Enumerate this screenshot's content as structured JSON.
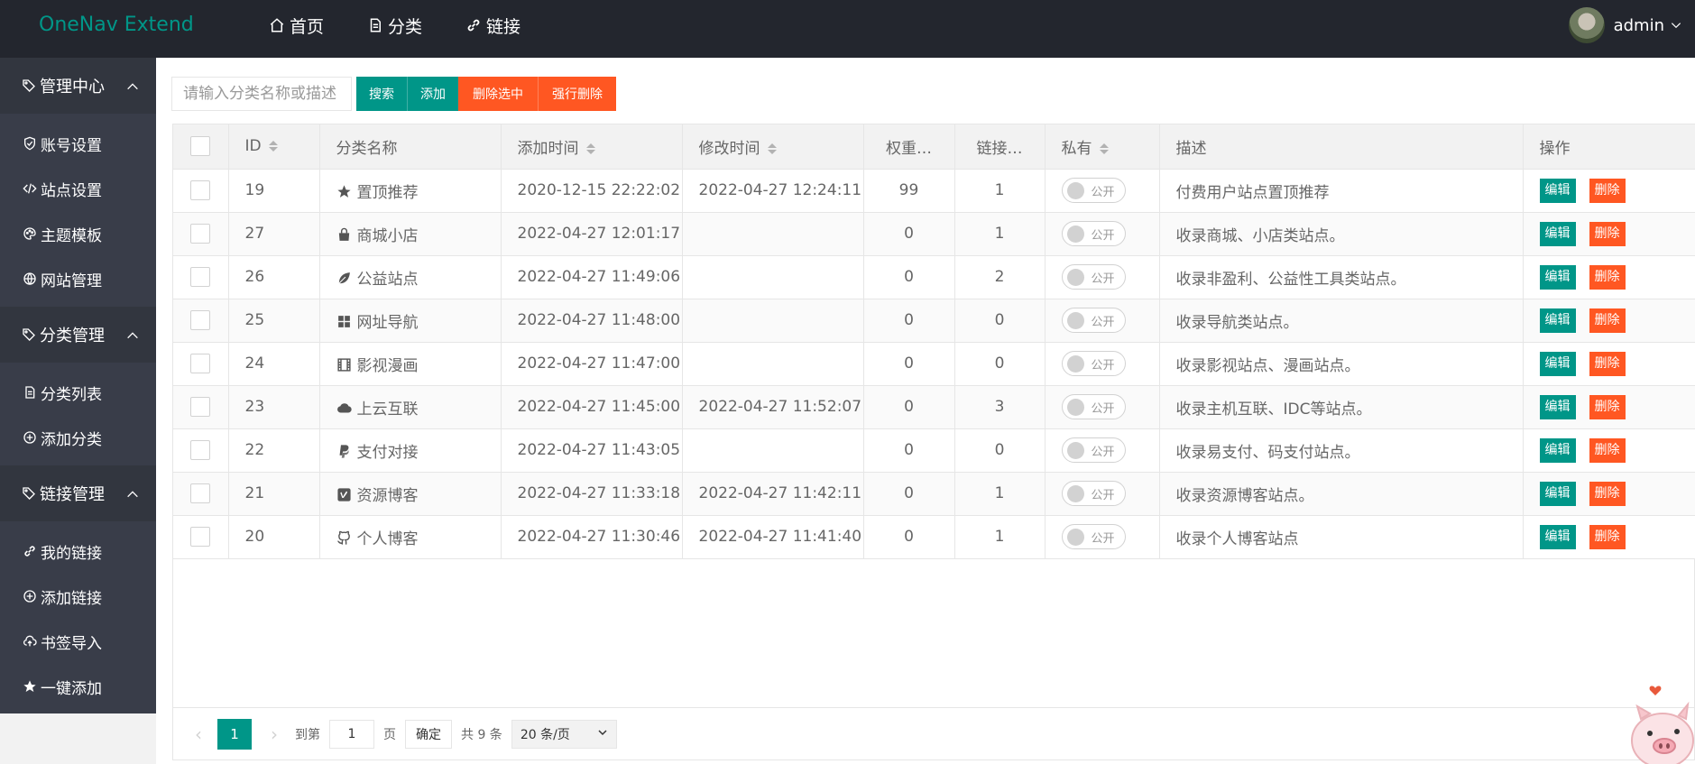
{
  "header": {
    "logo": "OneNav Extend",
    "nav": [
      {
        "label": "首页",
        "icon": "home-icon"
      },
      {
        "label": "分类",
        "icon": "document-icon"
      },
      {
        "label": "链接",
        "icon": "link-icon"
      }
    ],
    "user": {
      "name": "admin"
    }
  },
  "sidebar": {
    "groups": [
      {
        "title": "管理中心",
        "items": [
          "账号设置",
          "站点设置",
          "主题模板",
          "网站管理"
        ]
      },
      {
        "title": "分类管理",
        "items": [
          "分类列表",
          "添加分类"
        ]
      },
      {
        "title": "链接管理",
        "items": [
          "我的链接",
          "添加链接",
          "书签导入",
          "一键添加"
        ]
      }
    ]
  },
  "toolbar": {
    "search_placeholder": "请输入分类名称或描述",
    "search_label": "搜索",
    "add_label": "添加",
    "delete_selected_label": "删除选中",
    "force_delete_label": "强行删除"
  },
  "table": {
    "headers": {
      "id": "ID",
      "name": "分类名称",
      "add_time": "添加时间",
      "modify_time": "修改时间",
      "weight": "权重…",
      "links": "链接…",
      "private": "私有",
      "desc": "描述",
      "ops": "操作"
    },
    "switch_label": "公开",
    "edit_label": "编辑",
    "delete_label": "删除",
    "rows": [
      {
        "id": "19",
        "icon": "star-icon",
        "name": "置顶推荐",
        "add_time": "2020-12-15 22:22:02",
        "modify_time": "2022-04-27 12:24:11",
        "weight": "99",
        "links": "1",
        "desc": "付费用户站点置顶推荐"
      },
      {
        "id": "27",
        "icon": "shopping-bag-icon",
        "name": "商城小店",
        "add_time": "2022-04-27 12:01:17",
        "modify_time": "",
        "weight": "0",
        "links": "1",
        "desc": "收录商城、小店类站点。"
      },
      {
        "id": "26",
        "icon": "leaf-icon",
        "name": "公益站点",
        "add_time": "2022-04-27 11:49:06",
        "modify_time": "",
        "weight": "0",
        "links": "2",
        "desc": "收录非盈利、公益性工具类站点。"
      },
      {
        "id": "25",
        "icon": "grid-icon",
        "name": "网址导航",
        "add_time": "2022-04-27 11:48:00",
        "modify_time": "",
        "weight": "0",
        "links": "0",
        "desc": "收录导航类站点。"
      },
      {
        "id": "24",
        "icon": "film-icon",
        "name": "影视漫画",
        "add_time": "2022-04-27 11:47:00",
        "modify_time": "",
        "weight": "0",
        "links": "0",
        "desc": "收录影视站点、漫画站点。"
      },
      {
        "id": "23",
        "icon": "cloud-icon",
        "name": "上云互联",
        "add_time": "2022-04-27 11:45:00",
        "modify_time": "2022-04-27 11:52:07",
        "weight": "0",
        "links": "3",
        "desc": "收录主机互联、IDC等站点。"
      },
      {
        "id": "22",
        "icon": "paypal-icon",
        "name": "支付对接",
        "add_time": "2022-04-27 11:43:05",
        "modify_time": "",
        "weight": "0",
        "links": "0",
        "desc": "收录易支付、码支付站点。"
      },
      {
        "id": "21",
        "icon": "vimeo-icon",
        "name": "资源博客",
        "add_time": "2022-04-27 11:33:18",
        "modify_time": "2022-04-27 11:42:11",
        "weight": "0",
        "links": "1",
        "desc": "收录资源博客站点。"
      },
      {
        "id": "20",
        "icon": "github-icon",
        "name": "个人博客",
        "add_time": "2022-04-27 11:30:46",
        "modify_time": "2022-04-27 11:41:40",
        "weight": "0",
        "links": "1",
        "desc": "收录个人博客站点"
      }
    ]
  },
  "pager": {
    "current": "1",
    "goto_label": "到第",
    "page_value": "1",
    "page_label": "页",
    "confirm_label": "确定",
    "total_label": "共 9 条",
    "limit_label": "20 条/页"
  }
}
